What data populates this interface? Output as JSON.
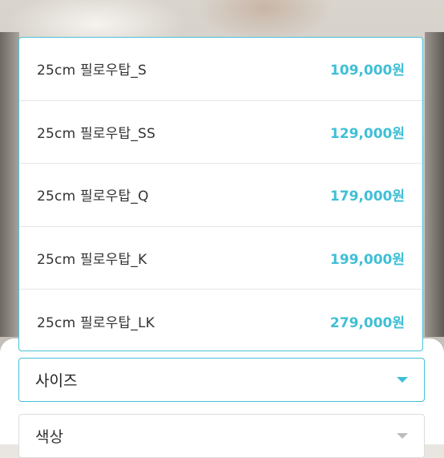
{
  "options": [
    {
      "name": "25cm 필로우탑_S",
      "price": "109,000원"
    },
    {
      "name": "25cm 필로우탑_SS",
      "price": "129,000원"
    },
    {
      "name": "25cm 필로우탑_Q",
      "price": "179,000원"
    },
    {
      "name": "25cm 필로우탑_K",
      "price": "199,000원"
    },
    {
      "name": "25cm 필로우탑_LK",
      "price": "279,000원"
    }
  ],
  "selects": {
    "size_label": "사이즈",
    "color_label": "색상"
  },
  "icons": {
    "size_caret": "chevron-down-icon",
    "color_caret": "chevron-down-icon"
  },
  "colors": {
    "accent": "#3fbfd6",
    "border_active": "#48c1d9",
    "border_inactive": "#dcdcdc"
  }
}
